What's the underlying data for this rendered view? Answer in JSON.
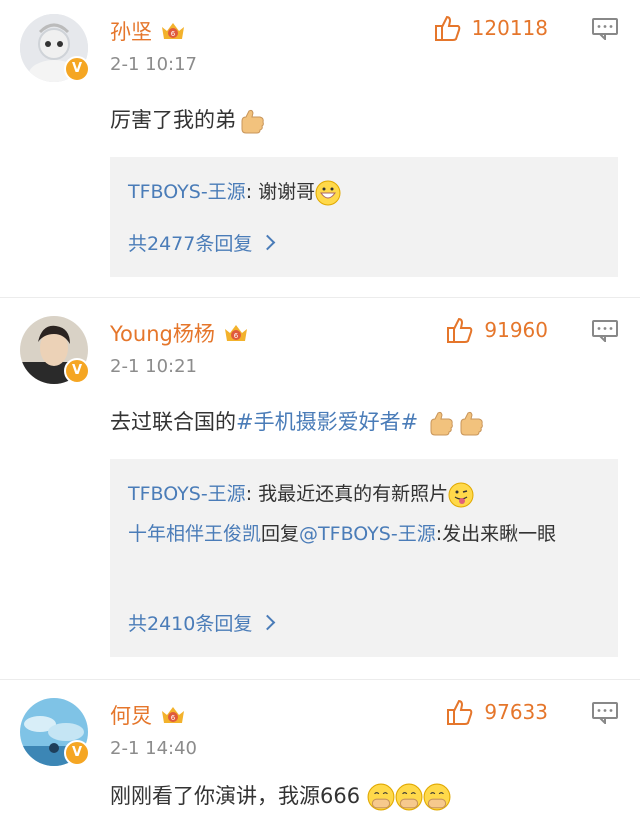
{
  "comments": [
    {
      "name": "孙坚",
      "time": "2-1 10:17",
      "likes": "120118",
      "text": "厉害了我的弟",
      "replies": [
        {
          "name": "TFBOYS-王源",
          "sep": ": ",
          "text": "谢谢哥"
        }
      ],
      "more": "共2477条回复"
    },
    {
      "name": "Young杨杨",
      "time": "2-1 10:21",
      "likes": "91960",
      "text_prefix": "去过联合国的",
      "topic": "#手机摄影爱好者#",
      "replies": [
        {
          "name": "TFBOYS-王源",
          "sep": ": ",
          "text": "我最近还真的有新照片"
        },
        {
          "name": "十年相伴王俊凯",
          "mid": "回复",
          "at": "@TFBOYS-王源",
          "text": ":发出来瞅一眼"
        }
      ],
      "more": "共2410条回复"
    },
    {
      "name": "何炅",
      "time": "2-1 14:40",
      "likes": "97633",
      "text": "刚刚看了你演讲，我源666"
    }
  ],
  "icons": {
    "verified": "verified-v-badge",
    "crown": "vip-crown-icon",
    "like": "thumbs-up-icon",
    "menu": "comment-menu-icon"
  },
  "colors": {
    "name": "#e5762b",
    "link": "#4a7cb8",
    "time": "#8c8c8c",
    "reply_bg": "#f2f2f2"
  }
}
